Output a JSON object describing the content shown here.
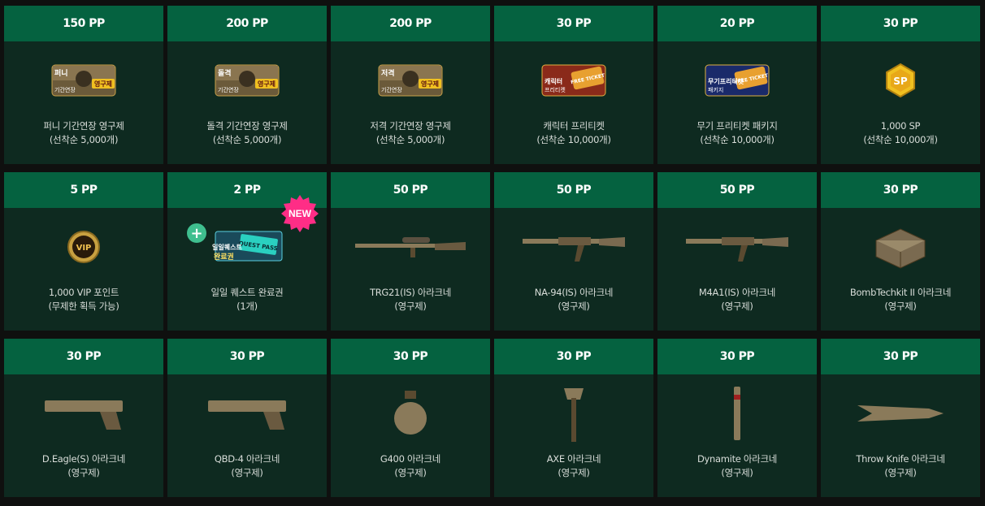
{
  "items": [
    {
      "price": "150 PP",
      "name": "퍼니 기간연장 영구제",
      "sub": "(선착순 5,000개)",
      "icon": "permanent-extension-ticket-icon",
      "ticket_text": "퍼니",
      "ticket_sub": "기간연장",
      "ticket_tag": "영구제"
    },
    {
      "price": "200 PP",
      "name": "돌격 기간연장 영구제",
      "sub": "(선착순 5,000개)",
      "icon": "permanent-extension-ticket-icon",
      "ticket_text": "돌격",
      "ticket_sub": "기간연장",
      "ticket_tag": "영구제"
    },
    {
      "price": "200 PP",
      "name": "저격 기간연장 영구제",
      "sub": "(선착순 5,000개)",
      "icon": "permanent-extension-ticket-icon",
      "ticket_text": "저격",
      "ticket_sub": "기간연장",
      "ticket_tag": "영구제"
    },
    {
      "price": "30 PP",
      "name": "캐릭터 프리티켓",
      "sub": "(선착순 10,000개)",
      "icon": "character-free-ticket-icon",
      "ticket_text": "캐릭터",
      "ticket_sub": "프리티켓",
      "ticket_tag": "FREE TICKET"
    },
    {
      "price": "20 PP",
      "name": "무기 프리티켓 패키지",
      "sub": "(선착순 10,000개)",
      "icon": "weapon-free-ticket-icon",
      "ticket_text": "무기프리티켓",
      "ticket_sub": "패키지",
      "ticket_tag": "FREE TICKET"
    },
    {
      "price": "30 PP",
      "name": "1,000 SP",
      "sub": "(선착순 10,000개)",
      "icon": "sp-coin-icon",
      "coin_text": "SP"
    },
    {
      "price": "5 PP",
      "name": "1,000 VIP 포인트",
      "sub": "(무제한 획득 가능)",
      "icon": "vip-coin-icon",
      "coin_text": "VIP"
    },
    {
      "price": "2 PP",
      "name": "일일 퀘스트 완료권",
      "sub": "(1개)",
      "icon": "quest-pass-icon",
      "ticket_text": "일일퀘스트",
      "ticket_sub": "완료권",
      "ticket_tag": "QUEST PASS"
    },
    {
      "price": "50 PP",
      "name": "TRG21(IS) 아라크네",
      "sub": "(영구제)",
      "icon": "sniper-rifle-icon"
    },
    {
      "price": "50 PP",
      "name": "NA-94(IS) 아라크네",
      "sub": "(영구제)",
      "icon": "assault-rifle-icon"
    },
    {
      "price": "50 PP",
      "name": "M4A1(IS) 아라크네",
      "sub": "(영구제)",
      "icon": "assault-rifle-icon"
    },
    {
      "price": "30 PP",
      "name": "BombTechkit II 아라크네",
      "sub": "(영구제)",
      "icon": "bomb-techkit-icon"
    },
    {
      "price": "30 PP",
      "name": "D.Eagle(S) 아라크네",
      "sub": "(영구제)",
      "icon": "pistol-icon"
    },
    {
      "price": "30 PP",
      "name": "QBD-4 아라크네",
      "sub": "(영구제)",
      "icon": "pistol-icon"
    },
    {
      "price": "30 PP",
      "name": "G400 아라크네",
      "sub": "(영구제)",
      "icon": "grenade-icon"
    },
    {
      "price": "30 PP",
      "name": "AXE 아라크네",
      "sub": "(영구제)",
      "icon": "axe-icon"
    },
    {
      "price": "30 PP",
      "name": "Dynamite 아라크네",
      "sub": "(영구제)",
      "icon": "dynamite-icon"
    },
    {
      "price": "30 PP",
      "name": "Throw Knife 아라크네",
      "sub": "(영구제)",
      "icon": "throwing-knife-icon"
    }
  ],
  "badges": {
    "new": "NEW",
    "plus": "+"
  },
  "colors": {
    "header": "#056240",
    "card": "#0e2a20",
    "page": "#0f100f",
    "new_badge": "#ff2d86",
    "plus_badge": "#3fbf8f",
    "ticket_tag": "#f0c020"
  }
}
